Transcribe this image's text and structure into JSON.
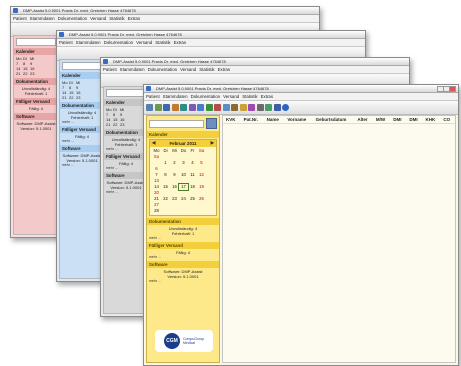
{
  "window_title": "DMP-Assist 5.0.9001 Praxis Dr. med. Gretchen Hasse 4764678",
  "menu": [
    "Patient",
    "Stammdaten",
    "Dokumentation",
    "Versand",
    "Statistik",
    "Extras"
  ],
  "sidebar": {
    "calendar_label": "Kalender",
    "month": "Februar 2011",
    "weekdays": [
      "Mo",
      "Di",
      "Mi",
      "Do",
      "Fr",
      "Sa",
      "So"
    ],
    "weeks": [
      [
        "",
        "1",
        "2",
        "3",
        "4",
        "5",
        "6"
      ],
      [
        "7",
        "8",
        "9",
        "10",
        "11",
        "12",
        "13"
      ],
      [
        "14",
        "15",
        "16",
        "17",
        "18",
        "19",
        "20"
      ],
      [
        "21",
        "22",
        "23",
        "24",
        "25",
        "26",
        "27"
      ],
      [
        "28",
        "",
        "",
        "",
        "",
        "",
        ""
      ]
    ],
    "doc_label": "Dokumentation",
    "doc_line1": "Unvollständig: 4",
    "doc_line2": "Fehlerhaft: 1",
    "due_label": "Fälliger Versand",
    "due_line": "Fällig: 4",
    "software_label": "Software",
    "software_line1": "Software: DMP-Assist",
    "software_line2": "Version: 5.1.0001",
    "more": "mehr ...",
    "brand_short": "CGM",
    "brand_line1": "CompuGroup",
    "brand_line2": "Medical"
  },
  "table_columns": [
    "KVK",
    "Pat.Nr.",
    "Name",
    "Vorname",
    "Geburtsdatum",
    "Alter",
    "M/W",
    "DMI",
    "DMI",
    "KHK",
    "CO"
  ],
  "colors": {
    "win1": "#f6dede",
    "win2": "#dde9f5",
    "win3": "#e9e9e9",
    "win4": "#fbf7e2",
    "accent": "#f3cf3c",
    "cgm_blue": "#1a3f8a"
  }
}
